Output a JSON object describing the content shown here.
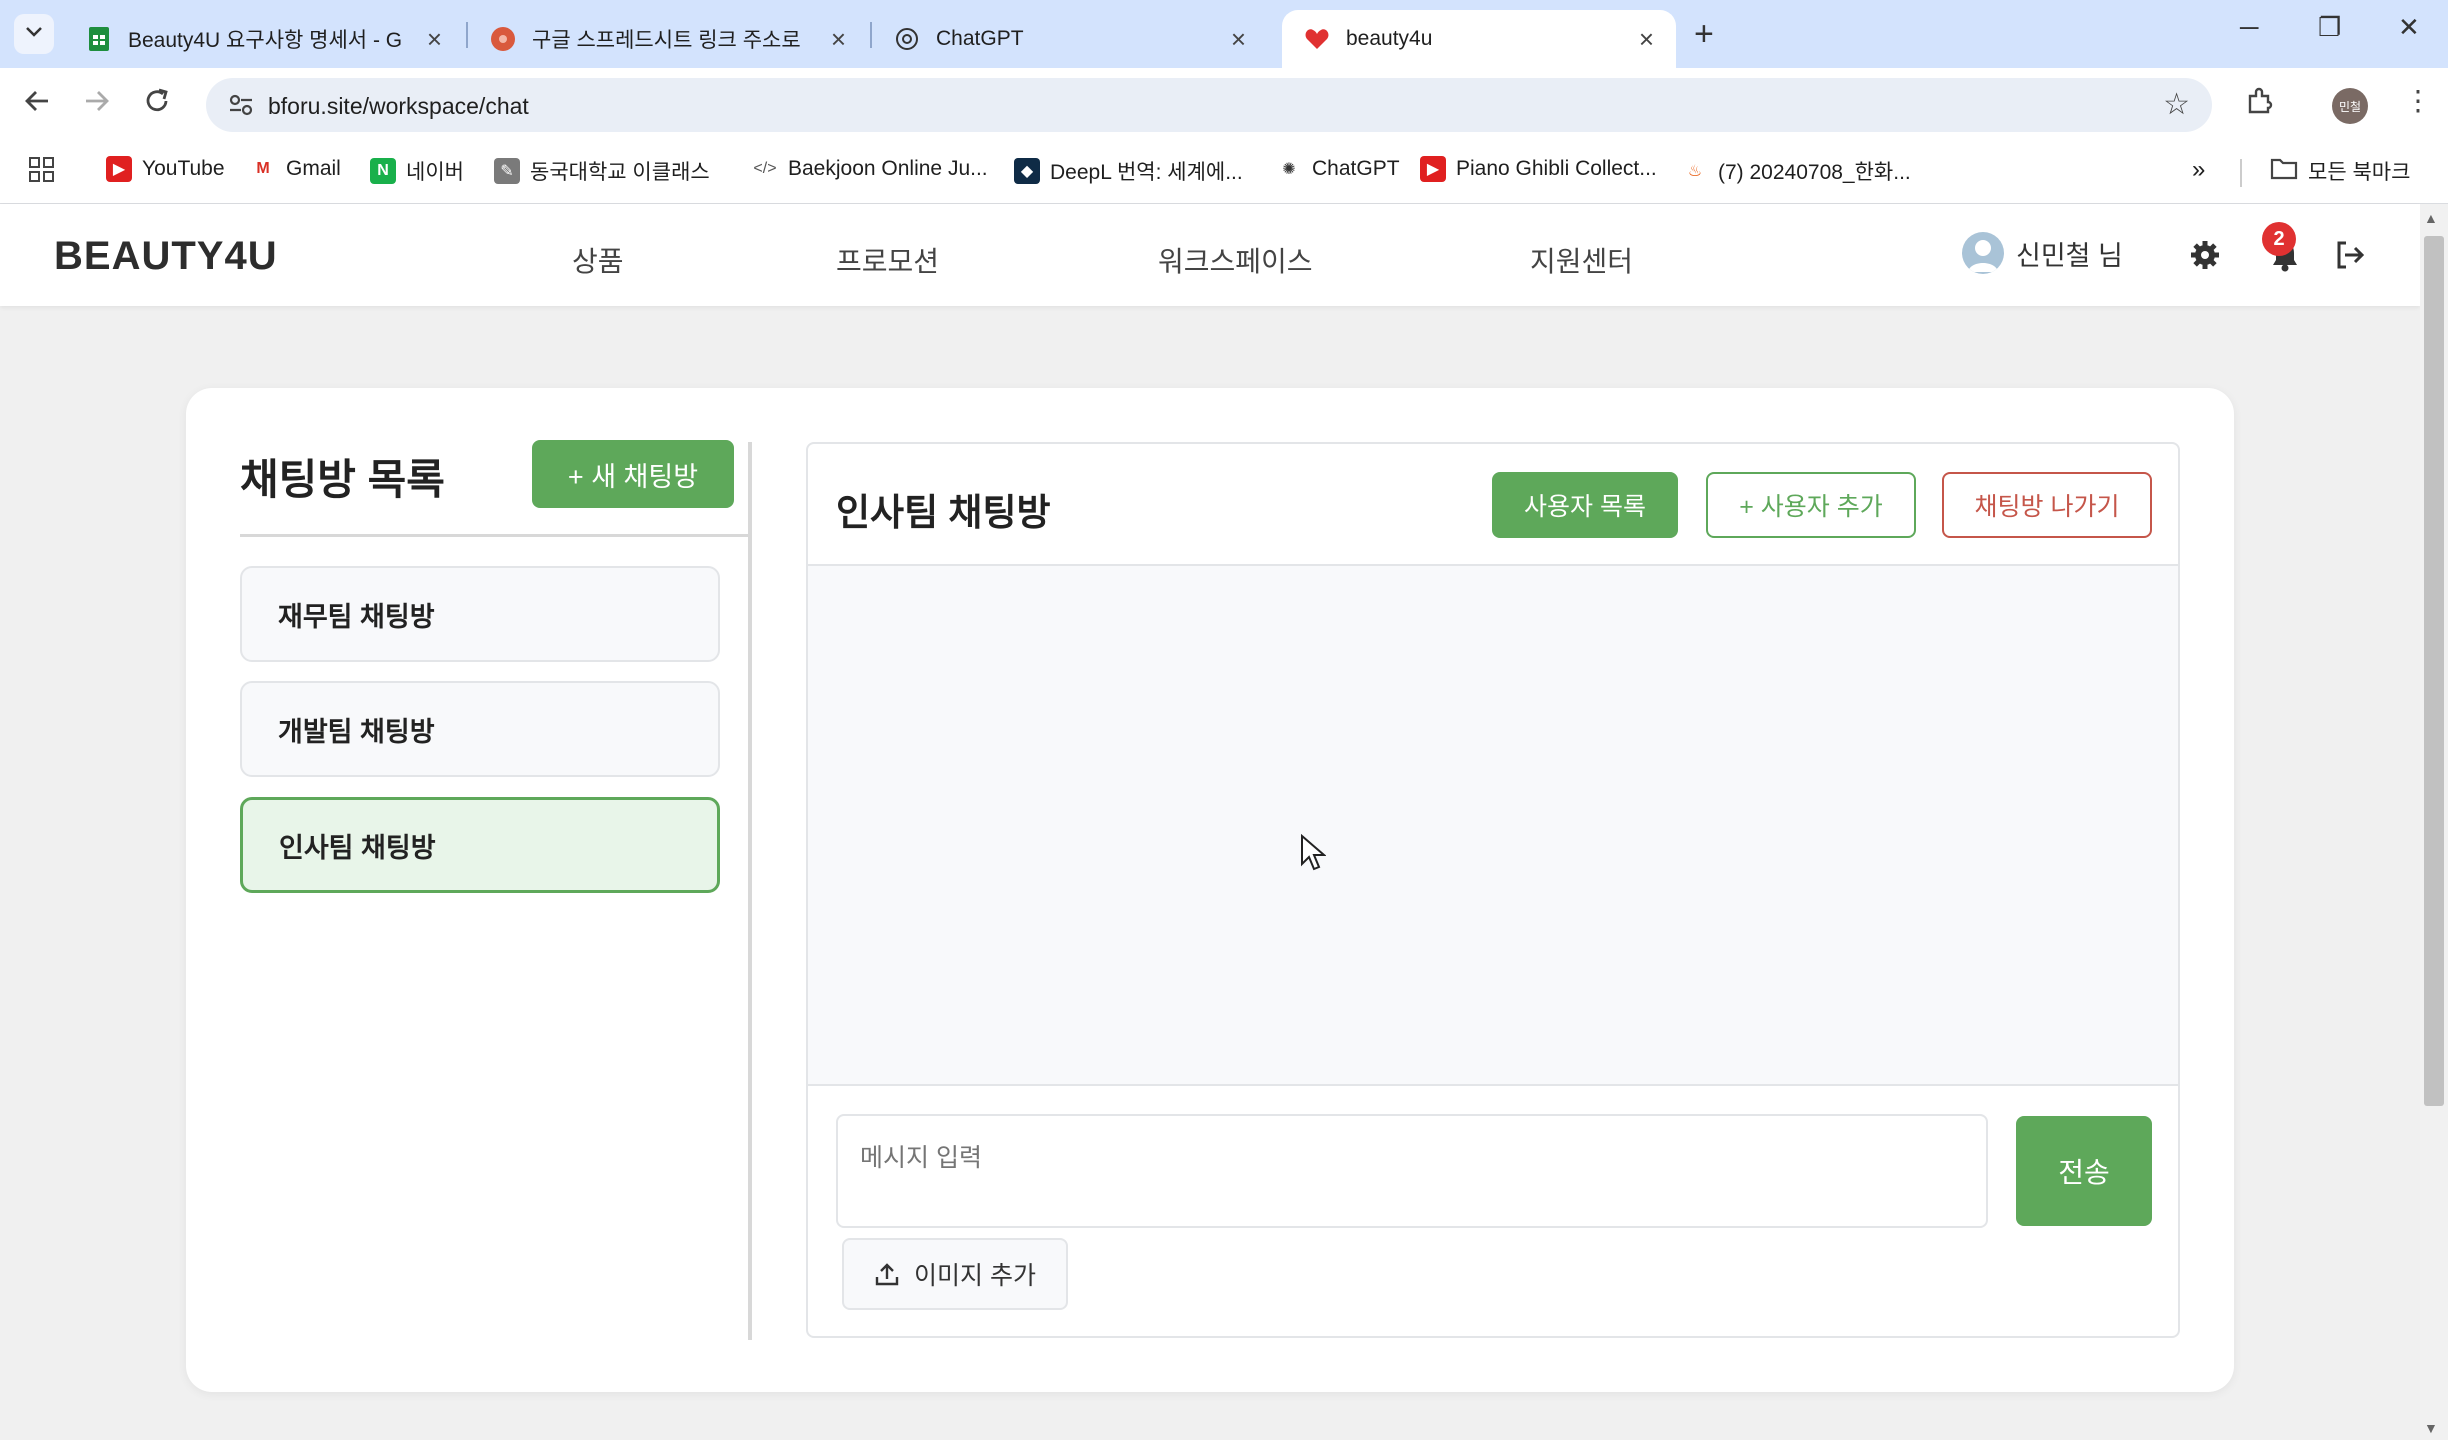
{
  "browser": {
    "tabs": [
      {
        "title": "Beauty4U 요구사항 명세서 - G",
        "icon": "google-sheets-icon",
        "active": false
      },
      {
        "title": "구글 스프레드시트 링크 주소로",
        "icon": "site-icon",
        "active": false
      },
      {
        "title": "ChatGPT",
        "icon": "chatgpt-icon",
        "active": false
      },
      {
        "title": "beauty4u",
        "icon": "heart-icon",
        "active": true
      }
    ],
    "url": "bforu.site/workspace/chat",
    "profile_initials": "민철",
    "bookmarks": [
      {
        "label": "YouTube",
        "icon": "youtube-icon"
      },
      {
        "label": "Gmail",
        "icon": "gmail-icon"
      },
      {
        "label": "네이버",
        "icon": "naver-icon"
      },
      {
        "label": "동국대학교 이클래스",
        "icon": "eclass-icon"
      },
      {
        "label": "Baekjoon Online Ju...",
        "icon": "code-icon"
      },
      {
        "label": "DeepL 번역: 세계에...",
        "icon": "deepl-icon"
      },
      {
        "label": "ChatGPT",
        "icon": "chatgpt-icon"
      },
      {
        "label": "Piano Ghibli Collect...",
        "icon": "youtube-icon"
      },
      {
        "label": "(7) 20240708_한화...",
        "icon": "fire-icon"
      }
    ],
    "all_bookmarks_label": "모든 북마크"
  },
  "app": {
    "logo": "BEAUTY4U",
    "nav": [
      "상품",
      "프로모션",
      "워크스페이스",
      "지원센터"
    ],
    "user_name": "신민철 님",
    "notification_count": "2"
  },
  "sidebar": {
    "title": "채팅방 목록",
    "new_room_label": "+ 새 채팅방",
    "rooms": [
      {
        "name": "재무팀 채팅방",
        "active": false
      },
      {
        "name": "개발팀 채팅방",
        "active": false
      },
      {
        "name": "인사팀 채팅방",
        "active": true
      }
    ]
  },
  "chat": {
    "title": "인사팀 채팅방",
    "user_list_label": "사용자 목록",
    "add_user_label": "+ 사용자 추가",
    "leave_label": "채팅방 나가기",
    "input_placeholder": "메시지 입력",
    "send_label": "전송",
    "add_image_label": "이미지 추가"
  },
  "colors": {
    "accent": "#5ea85a",
    "danger": "#c5564a",
    "badge": "#e03131"
  }
}
